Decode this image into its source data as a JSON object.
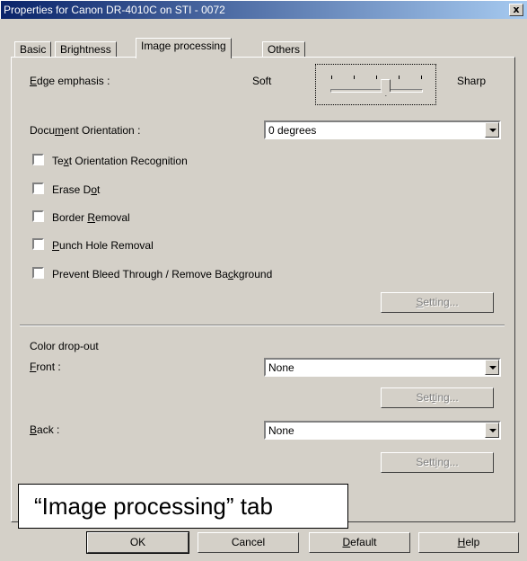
{
  "window": {
    "title": "Properties for Canon DR-4010C on STI - 0072",
    "close_label": "x"
  },
  "tabs": [
    {
      "label": "Basic",
      "active": false
    },
    {
      "label": "Brightness",
      "active": false
    },
    {
      "label": "Image processing",
      "active": true
    },
    {
      "label": "Others",
      "active": false
    }
  ],
  "edge": {
    "label_mn": "E",
    "label_rest": "dge emphasis :",
    "soft": "Soft",
    "sharp": "Sharp",
    "level_fraction": 0.6
  },
  "orientation": {
    "label_pre": "Docu",
    "label_mn": "m",
    "label_post": "ent Orientation :",
    "value": "0 degrees"
  },
  "checkboxes": [
    {
      "pre": "Te",
      "mn": "x",
      "post": "t Orientation Recognition",
      "checked": false
    },
    {
      "pre": "Erase D",
      "mn": "o",
      "post": "t",
      "checked": false
    },
    {
      "pre": "Border ",
      "mn": "R",
      "post": "emoval",
      "checked": false
    },
    {
      "pre": "",
      "mn": "P",
      "post": "unch Hole Removal",
      "checked": false
    },
    {
      "pre": "Prevent Bleed Through / Remove Ba",
      "mn": "c",
      "post": "kground",
      "checked": false
    }
  ],
  "setting_buttons": [
    {
      "pre": "",
      "mn": "S",
      "post": "etting..."
    },
    {
      "pre": "Set",
      "mn": "t",
      "post": "ing..."
    },
    {
      "pre": "Sett",
      "mn": "i",
      "post": "ng..."
    }
  ],
  "color_dropout": {
    "heading": "Color drop-out",
    "front_mn": "F",
    "front_rest": "ront :",
    "front_value": "None",
    "back_mn": "B",
    "back_rest": "ack :",
    "back_value": "None"
  },
  "caption": "“Image processing” tab",
  "footer": {
    "ok": "OK",
    "cancel": "Cancel",
    "default_mn": "D",
    "default_rest": "efault",
    "help_mn": "H",
    "help_rest": "elp"
  }
}
